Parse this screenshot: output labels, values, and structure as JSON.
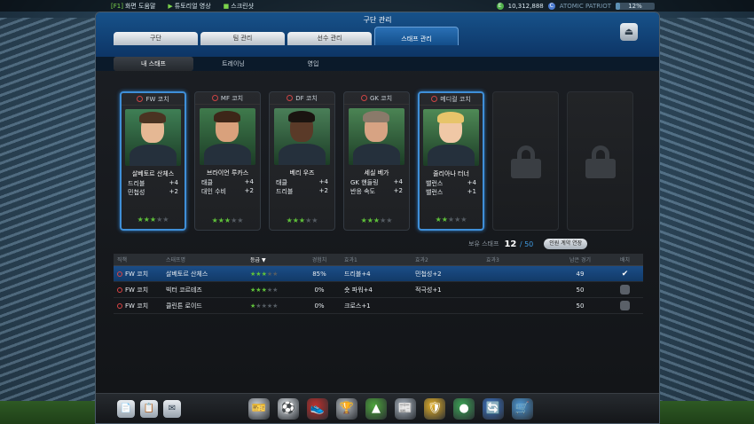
{
  "topbar": {
    "links": [
      {
        "key": "[F1]",
        "label": "화면 도움말"
      },
      {
        "key": "",
        "label": "튜토리얼 영상"
      },
      {
        "key": "",
        "label": "스크린샷"
      }
    ],
    "ep": "10,312,888",
    "coin_c": "C",
    "user": "ATOMIC PATRIOT",
    "progress": "12%"
  },
  "window": {
    "title": "구단 관리",
    "tabs": [
      "구단",
      "팀 관리",
      "선수 관리",
      "스태프 관리"
    ],
    "active_tab": 3,
    "subtabs": [
      "내 스태프",
      "트레이닝",
      "영입"
    ],
    "home_icon": "⏏"
  },
  "cards": [
    {
      "pos": "FW 코치",
      "name": "살베토르 산체스",
      "stats": [
        [
          "드리블",
          "+4"
        ],
        [
          "민첩성",
          "+2"
        ]
      ],
      "stars": 3,
      "selected": true,
      "hair": "#4a3322",
      "skin": "#e5b894",
      "bg": "#3f7f55"
    },
    {
      "pos": "MF 코치",
      "name": "브라이언 루카스",
      "stats": [
        [
          "태클",
          "+4"
        ],
        [
          "대인 수비",
          "+2"
        ]
      ],
      "stars": 3,
      "selected": false,
      "hair": "#3d2618",
      "skin": "#d9a17c",
      "bg": "#3f7a4c"
    },
    {
      "pos": "DF 코치",
      "name": "베리 우즈",
      "stats": [
        [
          "태클",
          "+4"
        ],
        [
          "드리블",
          "+2"
        ]
      ],
      "stars": 3,
      "selected": false,
      "hair": "#1a1410",
      "skin": "#5a3a28",
      "bg": "#4a7f58"
    },
    {
      "pos": "GK 코치",
      "name": "세실 베가",
      "stats": [
        [
          "GK 핸들링",
          "+4"
        ],
        [
          "반응 속도",
          "+2"
        ]
      ],
      "stars": 3,
      "selected": false,
      "hair": "#8a7a6a",
      "skin": "#d7a383",
      "bg": "#4b8454"
    },
    {
      "pos": "메디컬 코치",
      "name": "줄리아나 터너",
      "stats": [
        [
          "밸런스",
          "+4"
        ],
        [
          "밸런스",
          "+1"
        ]
      ],
      "stars": 2,
      "selected": true,
      "hair": "#e7c46a",
      "skin": "#f0c8a6",
      "bg": "#4f8a56"
    }
  ],
  "count": {
    "label": "보유 스태프",
    "current": "12",
    "max": "/ 50",
    "button": "인원 계약 연장"
  },
  "table": {
    "headers": [
      "직책",
      "스태프명",
      "등급 ▼",
      "경험치",
      "효과1",
      "효과2",
      "효과3",
      "남은 경기",
      "배치"
    ],
    "rows": [
      {
        "role": "FW 코치",
        "name": "살베토르 산체스",
        "stars": 3,
        "exp": "85%",
        "e1": "드리블+4",
        "e2": "민첩성+2",
        "e3": "",
        "games": "49",
        "placed": true
      },
      {
        "role": "FW 코치",
        "name": "빅터 코르테즈",
        "stars": 3,
        "exp": "0%",
        "e1": "숏 파워+4",
        "e2": "적극성+1",
        "e3": "",
        "games": "50",
        "placed": false
      },
      {
        "role": "FW 코치",
        "name": "클린튼 로이드",
        "stars": 1,
        "exp": "0%",
        "e1": "크로스+1",
        "e2": "",
        "e3": "",
        "games": "50",
        "placed": false
      }
    ]
  },
  "dock": {
    "left_icons": [
      "📄",
      "📋",
      "✉"
    ],
    "icons": [
      "🎫",
      "⚽",
      "👟",
      "🏆",
      "▲",
      "📰",
      "🛡",
      "●",
      "🔄",
      "🛒"
    ],
    "colors": [
      "#cfd5db",
      "#dfe5ea",
      "#c0302c",
      "#b9bec3",
      "#4ea63c",
      "#aab4bf",
      "#e6b22a",
      "#3da456",
      "#3b74c8",
      "#4d9ad9"
    ]
  }
}
